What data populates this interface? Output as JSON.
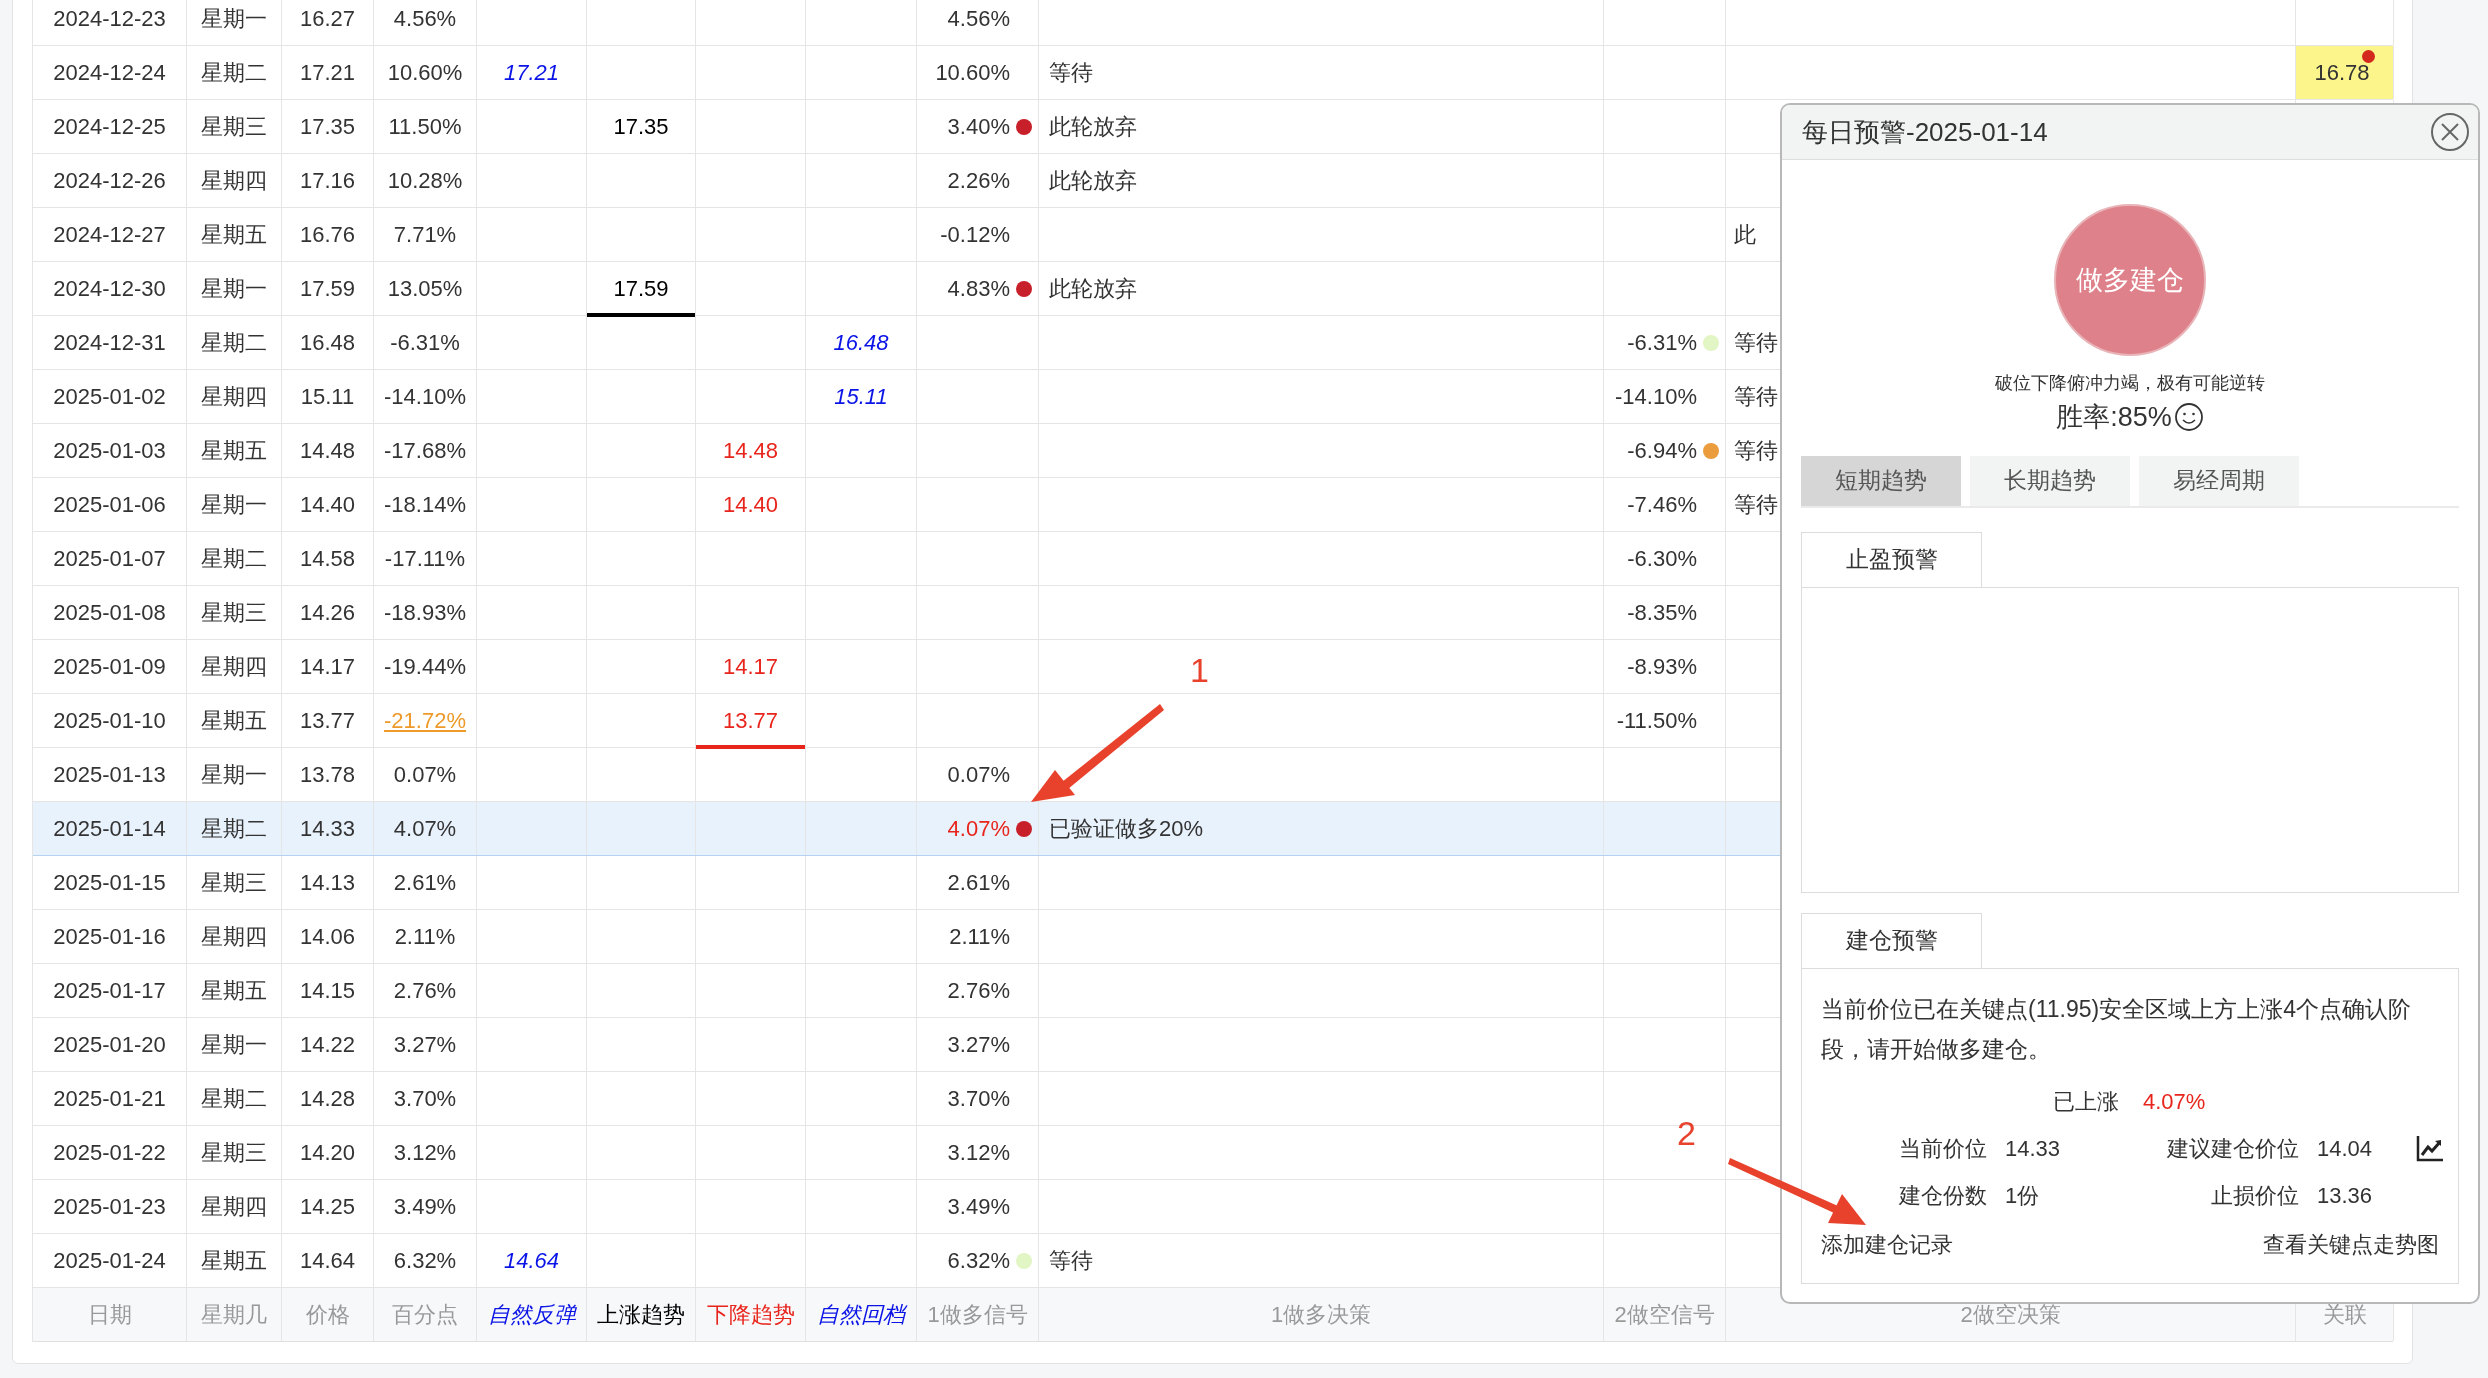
{
  "columns": [
    "日期",
    "星期几",
    "价格",
    "百分点",
    "自然反弹",
    "上涨趋势",
    "下降趋势",
    "自然回档",
    "1做多信号",
    "1做多决策",
    "2做空信号",
    "2做空决策",
    "关联"
  ],
  "rows": [
    {
      "date": "2024-12-23",
      "weekday": "星期一",
      "price": "16.27",
      "pct": "4.56%",
      "pct_alert": false,
      "up_end": false,
      "down_end": false,
      "selected": false,
      "long_signal": "4.56%"
    },
    {
      "date": "2024-12-24",
      "weekday": "星期二",
      "price": "17.21",
      "pct": "10.60%",
      "pct_alert": false,
      "up_end": false,
      "down_end": false,
      "selected": false,
      "rebound": "17.21",
      "long_signal": "10.60%",
      "long_decision": "等待",
      "link": "16.78",
      "link_dot": {
        "color": "#d42a1e"
      }
    },
    {
      "date": "2024-12-25",
      "weekday": "星期三",
      "price": "17.35",
      "pct": "11.50%",
      "pct_alert": false,
      "up_end": false,
      "down_end": false,
      "selected": false,
      "uptrend": "17.35",
      "long_signal": "3.40%",
      "long_dot": {
        "color": "#c8202a"
      },
      "long_decision": "此轮放弃"
    },
    {
      "date": "2024-12-26",
      "weekday": "星期四",
      "price": "17.16",
      "pct": "10.28%",
      "pct_alert": false,
      "up_end": false,
      "down_end": false,
      "selected": false,
      "long_signal": "2.26%",
      "long_decision": "此轮放弃"
    },
    {
      "date": "2024-12-27",
      "weekday": "星期五",
      "price": "16.76",
      "pct": "7.71%",
      "pct_alert": false,
      "up_end": false,
      "down_end": false,
      "selected": false,
      "long_signal": "-0.12%",
      "short_decision": "此"
    },
    {
      "date": "2024-12-30",
      "weekday": "星期一",
      "price": "17.59",
      "pct": "13.05%",
      "pct_alert": false,
      "up_end": true,
      "down_end": false,
      "selected": false,
      "uptrend": "17.59",
      "long_signal": "4.83%",
      "long_dot": {
        "color": "#c8202a"
      },
      "long_decision": "此轮放弃"
    },
    {
      "date": "2024-12-31",
      "weekday": "星期二",
      "price": "16.48",
      "pct": "-6.31%",
      "pct_alert": false,
      "up_end": false,
      "down_end": false,
      "selected": false,
      "pullback": "16.48",
      "short_signal": "-6.31%",
      "short_dot": {
        "color": "#e2f5c4"
      },
      "short_decision": "等待"
    },
    {
      "date": "2025-01-02",
      "weekday": "星期四",
      "price": "15.11",
      "pct": "-14.10%",
      "pct_alert": false,
      "up_end": false,
      "down_end": false,
      "selected": false,
      "pullback": "15.11",
      "short_signal": "-14.10%",
      "short_decision": "等待"
    },
    {
      "date": "2025-01-03",
      "weekday": "星期五",
      "price": "14.48",
      "pct": "-17.68%",
      "pct_alert": false,
      "up_end": false,
      "down_end": false,
      "selected": false,
      "downtrend": "14.48",
      "short_signal": "-6.94%",
      "short_dot": {
        "color": "#eb9c3c"
      },
      "short_decision": "等待"
    },
    {
      "date": "2025-01-06",
      "weekday": "星期一",
      "price": "14.40",
      "pct": "-18.14%",
      "pct_alert": false,
      "up_end": false,
      "down_end": false,
      "selected": false,
      "downtrend": "14.40",
      "short_signal": "-7.46%",
      "short_decision": "等待"
    },
    {
      "date": "2025-01-07",
      "weekday": "星期二",
      "price": "14.58",
      "pct": "-17.11%",
      "pct_alert": false,
      "up_end": false,
      "down_end": false,
      "selected": false,
      "short_signal": "-6.30%"
    },
    {
      "date": "2025-01-08",
      "weekday": "星期三",
      "price": "14.26",
      "pct": "-18.93%",
      "pct_alert": false,
      "up_end": false,
      "down_end": false,
      "selected": false,
      "short_signal": "-8.35%"
    },
    {
      "date": "2025-01-09",
      "weekday": "星期四",
      "price": "14.17",
      "pct": "-19.44%",
      "pct_alert": false,
      "up_end": false,
      "down_end": false,
      "selected": false,
      "downtrend": "14.17",
      "short_signal": "-8.93%"
    },
    {
      "date": "2025-01-10",
      "weekday": "星期五",
      "price": "13.77",
      "pct": "-21.72%",
      "pct_alert": true,
      "up_end": false,
      "down_end": true,
      "selected": false,
      "downtrend": "13.77",
      "short_signal": "-11.50%"
    },
    {
      "date": "2025-01-13",
      "weekday": "星期一",
      "price": "13.78",
      "pct": "0.07%",
      "pct_alert": false,
      "up_end": false,
      "down_end": false,
      "selected": false,
      "long_signal": "0.07%"
    },
    {
      "date": "2025-01-14",
      "weekday": "星期二",
      "price": "14.33",
      "pct": "4.07%",
      "pct_alert": false,
      "up_end": false,
      "down_end": false,
      "selected": true,
      "long_signal": "4.07%",
      "long_dot": {
        "color": "#c8202a"
      },
      "long_decision": "已验证做多20%"
    },
    {
      "date": "2025-01-15",
      "weekday": "星期三",
      "price": "14.13",
      "pct": "2.61%",
      "pct_alert": false,
      "up_end": false,
      "down_end": false,
      "selected": false,
      "long_signal": "2.61%"
    },
    {
      "date": "2025-01-16",
      "weekday": "星期四",
      "price": "14.06",
      "pct": "2.11%",
      "pct_alert": false,
      "up_end": false,
      "down_end": false,
      "selected": false,
      "long_signal": "2.11%"
    },
    {
      "date": "2025-01-17",
      "weekday": "星期五",
      "price": "14.15",
      "pct": "2.76%",
      "pct_alert": false,
      "up_end": false,
      "down_end": false,
      "selected": false,
      "long_signal": "2.76%"
    },
    {
      "date": "2025-01-20",
      "weekday": "星期一",
      "price": "14.22",
      "pct": "3.27%",
      "pct_alert": false,
      "up_end": false,
      "down_end": false,
      "selected": false,
      "long_signal": "3.27%"
    },
    {
      "date": "2025-01-21",
      "weekday": "星期二",
      "price": "14.28",
      "pct": "3.70%",
      "pct_alert": false,
      "up_end": false,
      "down_end": false,
      "selected": false,
      "long_signal": "3.70%"
    },
    {
      "date": "2025-01-22",
      "weekday": "星期三",
      "price": "14.20",
      "pct": "3.12%",
      "pct_alert": false,
      "up_end": false,
      "down_end": false,
      "selected": false,
      "long_signal": "3.12%"
    },
    {
      "date": "2025-01-23",
      "weekday": "星期四",
      "price": "14.25",
      "pct": "3.49%",
      "pct_alert": false,
      "up_end": false,
      "down_end": false,
      "selected": false,
      "long_signal": "3.49%"
    },
    {
      "date": "2025-01-24",
      "weekday": "星期五",
      "price": "14.64",
      "pct": "6.32%",
      "pct_alert": false,
      "up_end": false,
      "down_end": false,
      "selected": false,
      "rebound": "14.64",
      "long_signal": "6.32%",
      "long_dot": {
        "color": "#e2f5c4"
      },
      "long_decision": "等待"
    }
  ],
  "popup": {
    "title": "每日预警-2025-01-14",
    "action": "做多建仓",
    "reason": "破位下降俯冲力竭，极有可能逆转",
    "win_rate": "胜率:85%",
    "tabs": [
      {
        "label": "短期趋势",
        "selected": true
      },
      {
        "label": "长期趋势",
        "selected": false
      },
      {
        "label": "易经周期",
        "selected": false
      }
    ],
    "take_profit": {
      "label": "止盈预警"
    },
    "entry": {
      "label": "建仓预警",
      "message": "当前价位已在关键点(11.95)安全区域上方上涨4个点确认阶段，请开始做多建仓。",
      "rise_label": "已上涨",
      "rise_value": "4.07%",
      "fields": [
        {
          "label": "当前价位",
          "value": "14.33"
        },
        {
          "label": "建议建仓价位",
          "value": "14.04"
        },
        {
          "label": "建仓份数",
          "value": "1份"
        },
        {
          "label": "止损价位",
          "value": "13.36"
        }
      ],
      "add_link": "添加建仓记录",
      "chart_link": "查看关键点走势图"
    }
  },
  "annotations": [
    {
      "label": "1"
    },
    {
      "label": "2"
    }
  ]
}
